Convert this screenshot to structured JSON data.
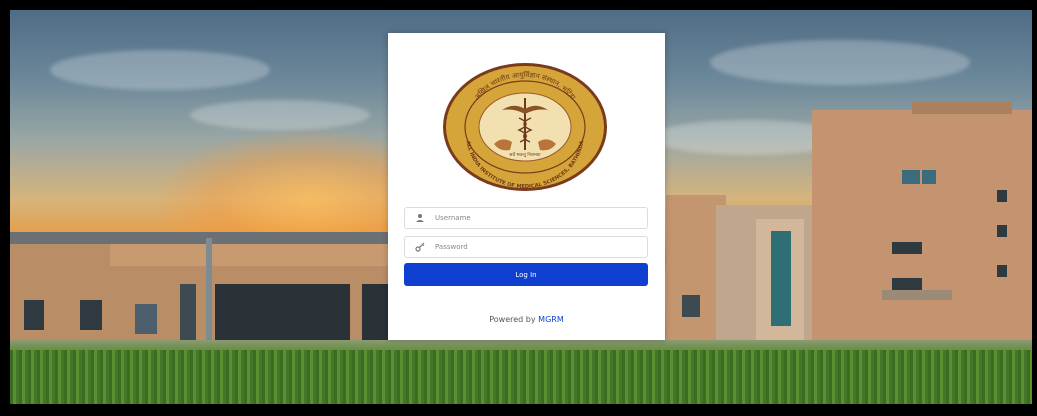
{
  "login": {
    "username_placeholder": "Username",
    "password_placeholder": "Password",
    "login_label": "Log In",
    "powered_by": "Powered by",
    "powered_brand": "MGRM"
  },
  "logo": {
    "top_text": "अखिल भारतीय आयुर्विज्ञान संस्थान, भटिंडा",
    "bottom_text": "ALL INDIA INSTITUTE OF MEDICAL SCIENCES, BATHINDA",
    "motto": "सर्वे भवन्तु निरामया"
  },
  "colors": {
    "accent": "#0f3fd0",
    "logo_gold": "#d6a53a"
  },
  "icons": {
    "username": "user-icon",
    "password": "key-icon"
  }
}
